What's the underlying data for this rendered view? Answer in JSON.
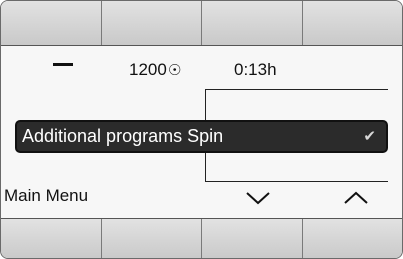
{
  "status": {
    "spin_speed": "1200",
    "spin_icon": "spiral-icon",
    "time": "0:13h"
  },
  "selection": {
    "label": "Additional programs Spin",
    "check_icon": "checkmark-icon"
  },
  "nav": {
    "main_menu": "Main Menu",
    "down_icon": "chevron-down-icon",
    "up_icon": "chevron-up-icon"
  },
  "keys": {
    "top_count": 4,
    "bottom_count": 4
  }
}
